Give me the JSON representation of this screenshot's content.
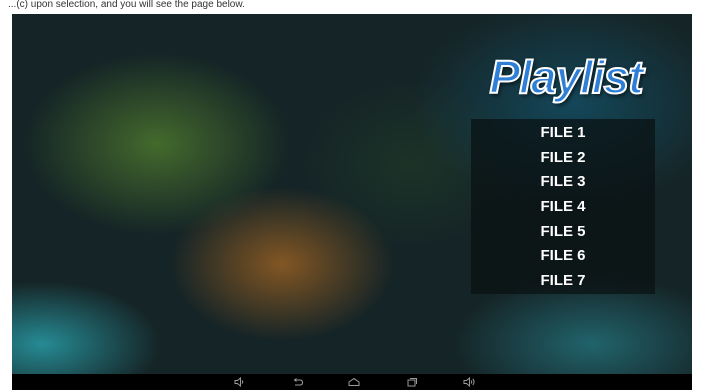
{
  "caption": "...(c) upon selection, and you will see the page below.",
  "playlist": {
    "title": "Playlist",
    "files": [
      "FILE 1",
      "FILE 2",
      "FILE 3",
      "FILE 4",
      "FILE 5",
      "FILE 6",
      "FILE 7"
    ]
  },
  "navbar": {
    "icons": [
      "volume-down-icon",
      "back-icon",
      "home-icon",
      "recent-apps-icon",
      "volume-up-icon"
    ]
  },
  "colors": {
    "title_fill": "#2f7fd6",
    "title_stroke": "#ffffff",
    "list_background": "rgba(10,16,18,0.72)",
    "navbar": "#000000"
  }
}
